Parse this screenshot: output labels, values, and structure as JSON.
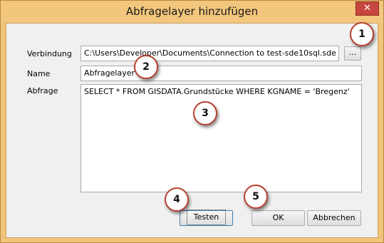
{
  "window": {
    "title": "Abfragelayer hinzufügen",
    "close_glyph": "✕"
  },
  "form": {
    "connection_label": "Verbindung",
    "connection_value": "C:\\Users\\Developer\\Documents\\Connection to test-sde10sql.sde",
    "browse_label": "...",
    "name_label": "Name",
    "name_value": "Abfragelayer",
    "query_label": "Abfrage",
    "query_value": "SELECT * FROM GISDATA.Grundstücke WHERE KGNAME = 'Bregenz'"
  },
  "buttons": {
    "test_label": "Testen",
    "ok_label": "OK",
    "cancel_label": "Abbrechen"
  },
  "markers": [
    "1",
    "2",
    "3",
    "4",
    "5"
  ],
  "colors": {
    "frame": "#f2c67c",
    "close": "#c7463d",
    "marker_border": "#b8412f"
  }
}
